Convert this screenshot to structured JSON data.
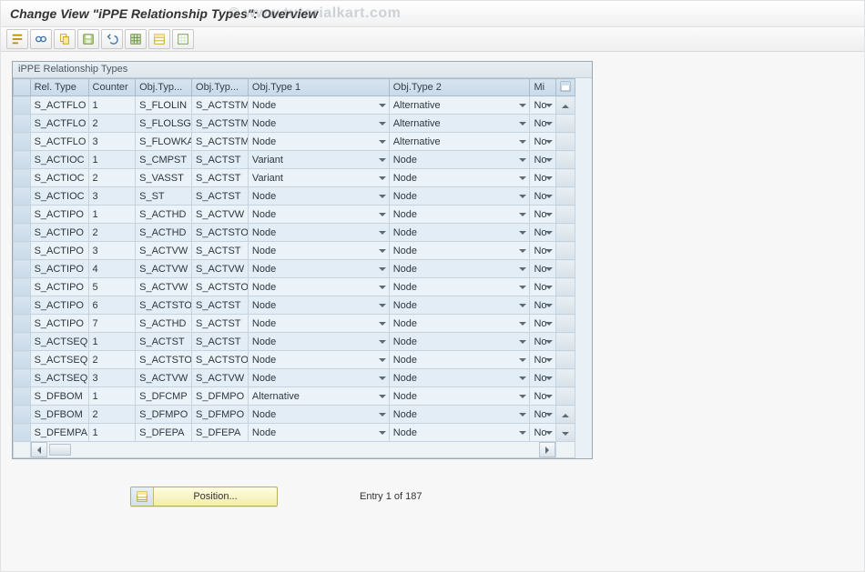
{
  "title": "Change View \"iPPE Relationship Types\": Overview",
  "watermark": "© www.tutorialkart.com",
  "panel_title": "iPPE Relationship Types",
  "columns": {
    "rel_type": "Rel. Type",
    "counter": "Counter",
    "objtyp1": "Obj.Typ...",
    "objtyp2": "Obj.Typ...",
    "objtype1": "Obj.Type 1",
    "objtype2": "Obj.Type 2",
    "min": "Mi"
  },
  "rows": [
    {
      "rel": "S_ACTFLO",
      "ctr": "1",
      "t1": "S_FLOLIN",
      "t2": "S_ACTSTM",
      "o1": "Node",
      "o2": "Alternative",
      "m": "No"
    },
    {
      "rel": "S_ACTFLO",
      "ctr": "2",
      "t1": "S_FLOLSG",
      "t2": "S_ACTSTM",
      "o1": "Node",
      "o2": "Alternative",
      "m": "No"
    },
    {
      "rel": "S_ACTFLO",
      "ctr": "3",
      "t1": "S_FLOWKA",
      "t2": "S_ACTSTM",
      "o1": "Node",
      "o2": "Alternative",
      "m": "No"
    },
    {
      "rel": "S_ACTIOC",
      "ctr": "1",
      "t1": "S_CMPST",
      "t2": "S_ACTST",
      "o1": "Variant",
      "o2": "Node",
      "m": "No"
    },
    {
      "rel": "S_ACTIOC",
      "ctr": "2",
      "t1": "S_VASST",
      "t2": "S_ACTST",
      "o1": "Variant",
      "o2": "Node",
      "m": "No"
    },
    {
      "rel": "S_ACTIOC",
      "ctr": "3",
      "t1": "S_ST",
      "t2": "S_ACTST",
      "o1": "Node",
      "o2": "Node",
      "m": "No"
    },
    {
      "rel": "S_ACTIPO",
      "ctr": "1",
      "t1": "S_ACTHD",
      "t2": "S_ACTVW",
      "o1": "Node",
      "o2": "Node",
      "m": "No"
    },
    {
      "rel": "S_ACTIPO",
      "ctr": "2",
      "t1": "S_ACTHD",
      "t2": "S_ACTSTO",
      "o1": "Node",
      "o2": "Node",
      "m": "No"
    },
    {
      "rel": "S_ACTIPO",
      "ctr": "3",
      "t1": "S_ACTVW",
      "t2": "S_ACTST",
      "o1": "Node",
      "o2": "Node",
      "m": "No"
    },
    {
      "rel": "S_ACTIPO",
      "ctr": "4",
      "t1": "S_ACTVW",
      "t2": "S_ACTVW",
      "o1": "Node",
      "o2": "Node",
      "m": "No"
    },
    {
      "rel": "S_ACTIPO",
      "ctr": "5",
      "t1": "S_ACTVW",
      "t2": "S_ACTSTO",
      "o1": "Node",
      "o2": "Node",
      "m": "No"
    },
    {
      "rel": "S_ACTIPO",
      "ctr": "6",
      "t1": "S_ACTSTO",
      "t2": "S_ACTST",
      "o1": "Node",
      "o2": "Node",
      "m": "No"
    },
    {
      "rel": "S_ACTIPO",
      "ctr": "7",
      "t1": "S_ACTHD",
      "t2": "S_ACTST",
      "o1": "Node",
      "o2": "Node",
      "m": "No"
    },
    {
      "rel": "S_ACTSEQ",
      "ctr": "1",
      "t1": "S_ACTST",
      "t2": "S_ACTST",
      "o1": "Node",
      "o2": "Node",
      "m": "No"
    },
    {
      "rel": "S_ACTSEQ",
      "ctr": "2",
      "t1": "S_ACTSTO",
      "t2": "S_ACTSTO",
      "o1": "Node",
      "o2": "Node",
      "m": "No"
    },
    {
      "rel": "S_ACTSEQ",
      "ctr": "3",
      "t1": "S_ACTVW",
      "t2": "S_ACTVW",
      "o1": "Node",
      "o2": "Node",
      "m": "No"
    },
    {
      "rel": "S_DFBOM",
      "ctr": "1",
      "t1": "S_DFCMP",
      "t2": "S_DFMPO",
      "o1": "Alternative",
      "o2": "Node",
      "m": "No"
    },
    {
      "rel": "S_DFBOM",
      "ctr": "2",
      "t1": "S_DFMPO",
      "t2": "S_DFMPO",
      "o1": "Node",
      "o2": "Node",
      "m": "No"
    },
    {
      "rel": "S_DFEMPA",
      "ctr": "1",
      "t1": "S_DFEPA",
      "t2": "S_DFEPA",
      "o1": "Node",
      "o2": "Node",
      "m": "No"
    }
  ],
  "footer": {
    "position_label": "Position...",
    "entry_label": "Entry 1 of 187"
  },
  "toolbar_icons": [
    "other-view",
    "glasses",
    "copy",
    "save",
    "undo",
    "select-all",
    "table-settings",
    "deselect-all"
  ]
}
